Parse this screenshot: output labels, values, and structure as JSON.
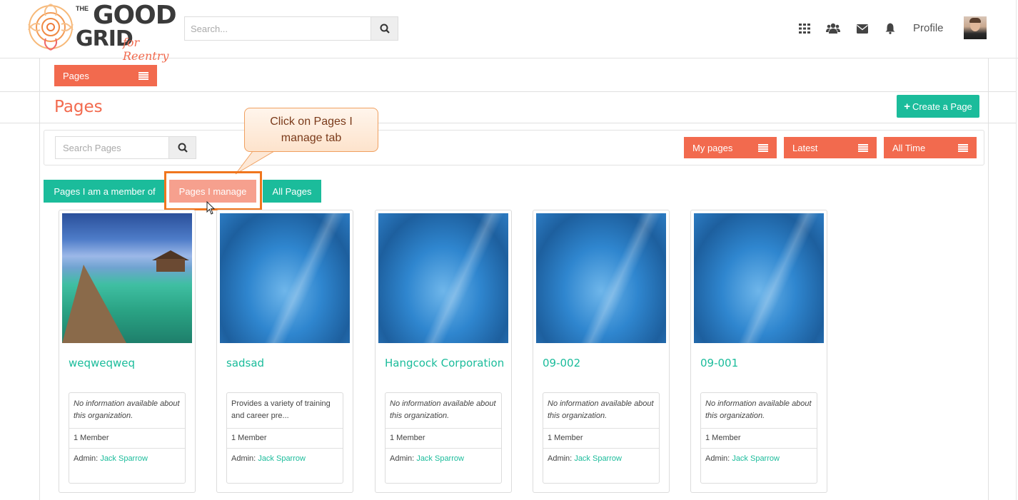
{
  "header": {
    "logo": {
      "the": "THE",
      "good": "GOOD",
      "grid": "GRID",
      "tagline": "for Reentry"
    },
    "search_placeholder": "Search...",
    "icons": [
      "apps-grid-icon",
      "users-icon",
      "envelope-icon",
      "bell-icon"
    ],
    "profile_label": "Profile"
  },
  "nav": {
    "pages_menu_label": "Pages"
  },
  "page": {
    "title": "Pages",
    "create_button_label": "Create a Page"
  },
  "filters": {
    "search_placeholder": "Search Pages",
    "buttons": [
      "My pages",
      "Latest",
      "All Time"
    ]
  },
  "tabs": [
    {
      "label": "Pages I am a member of",
      "active": false
    },
    {
      "label": "Pages I manage",
      "active": true
    },
    {
      "label": "All Pages",
      "active": false
    }
  ],
  "callout": {
    "text_line1": "Click on Pages I",
    "text_line2": "manage tab"
  },
  "cards": [
    {
      "title": "weqweqweq",
      "description": "No information available about this organization.",
      "members": "1 Member",
      "admin_prefix": "Admin:",
      "admin_name": "Jack Sparrow"
    },
    {
      "title": "sadsad",
      "description": "Provides a variety of training and career pre...",
      "members": "1 Member",
      "admin_prefix": "Admin:",
      "admin_name": "Jack Sparrow"
    },
    {
      "title": "Hangcock Corporation",
      "description": "No information available about this organization.",
      "members": "1 Member",
      "admin_prefix": "Admin:",
      "admin_name": "Jack Sparrow"
    },
    {
      "title": "09-002",
      "description": "No information available about this organization.",
      "members": "1 Member",
      "admin_prefix": "Admin:",
      "admin_name": "Jack Sparrow"
    },
    {
      "title": "09-001",
      "description": "No information available about this organization.",
      "members": "1 Member",
      "admin_prefix": "Admin:",
      "admin_name": "Jack Sparrow"
    }
  ],
  "colors": {
    "accent_orange": "#f26a4e",
    "accent_teal": "#1bbc9b",
    "tab_active": "#f6a08e",
    "highlight": "#f0761e"
  }
}
